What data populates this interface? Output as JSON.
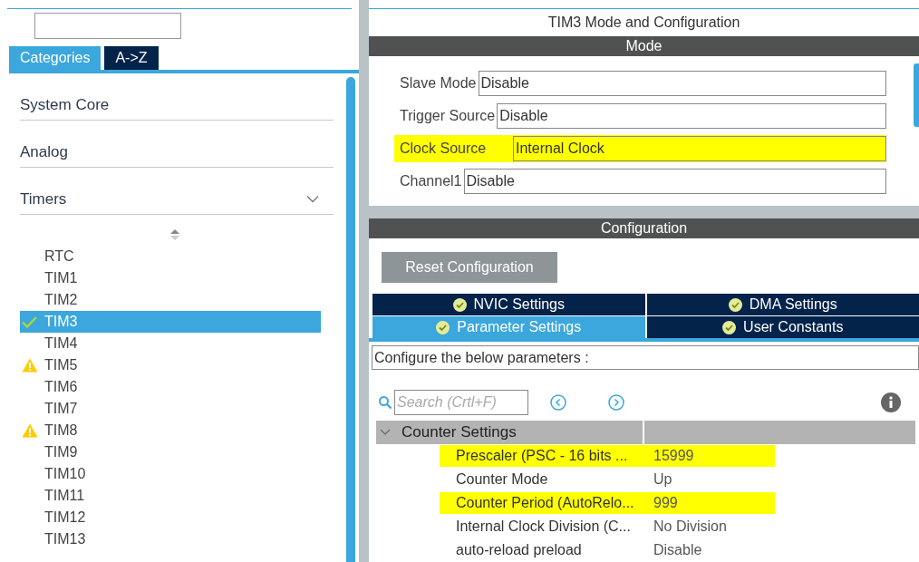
{
  "category_tabs": [
    {
      "label": "Categories",
      "selected": true
    },
    {
      "label": "A->Z",
      "selected": false
    }
  ],
  "categories": [
    {
      "label": "System Core"
    },
    {
      "label": "Analog"
    },
    {
      "label": "Timers",
      "expanded": true,
      "children": [
        {
          "label": "RTC",
          "selected": false,
          "configured": false,
          "warning": false
        },
        {
          "label": "TIM1",
          "selected": false,
          "configured": false,
          "warning": false
        },
        {
          "label": "TIM2",
          "selected": false,
          "configured": false,
          "warning": false
        },
        {
          "label": "TIM3",
          "selected": true,
          "configured": true,
          "warning": false
        },
        {
          "label": "TIM4",
          "selected": false,
          "configured": false,
          "warning": false
        },
        {
          "label": "TIM5",
          "selected": false,
          "configured": false,
          "warning": true
        },
        {
          "label": "TIM6",
          "selected": false,
          "configured": false,
          "warning": false
        },
        {
          "label": "TIM7",
          "selected": false,
          "configured": false,
          "warning": false
        },
        {
          "label": "TIM8",
          "selected": false,
          "configured": false,
          "warning": true
        },
        {
          "label": "TIM9",
          "selected": false,
          "configured": false,
          "warning": false
        },
        {
          "label": "TIM10",
          "selected": false,
          "configured": false,
          "warning": false
        },
        {
          "label": "TIM11",
          "selected": false,
          "configured": false,
          "warning": false
        },
        {
          "label": "TIM12",
          "selected": false,
          "configured": false,
          "warning": false
        },
        {
          "label": "TIM13",
          "selected": false,
          "configured": false,
          "warning": false
        }
      ]
    }
  ],
  "title": "TIM3 Mode and Configuration",
  "mode": {
    "header": "Mode",
    "fields": [
      {
        "label": "Slave Mode",
        "value": "Disable",
        "highlighted": false
      },
      {
        "label": "Trigger Source",
        "value": "Disable",
        "highlighted": false
      },
      {
        "label": "Clock Source",
        "value": "Internal Clock",
        "highlighted": true
      },
      {
        "label": "Channel1",
        "value": "Disable",
        "highlighted": false
      }
    ]
  },
  "configuration": {
    "header": "Configuration",
    "reset_button": "Reset Configuration",
    "tabs": [
      {
        "label": "NVIC Settings",
        "selected": false
      },
      {
        "label": "DMA Settings",
        "selected": false
      },
      {
        "label": "Parameter Settings",
        "selected": true
      },
      {
        "label": "User Constants",
        "selected": false
      }
    ],
    "description": "Configure the below parameters :",
    "search": {
      "placeholder": "Search (Crtl+F)"
    },
    "groups": [
      {
        "label": "Counter Settings",
        "expanded": true,
        "children": [
          {
            "name": "Prescaler (PSC - 16 bits ...",
            "value": "15999",
            "highlighted": true
          },
          {
            "name": "Counter Mode",
            "value": "Up",
            "highlighted": false
          },
          {
            "name": "Counter Period (AutoRelo...",
            "value": "999",
            "highlighted": true
          },
          {
            "name": "Internal Clock Division (C...",
            "value": "No Division",
            "highlighted": false
          },
          {
            "name": "auto-reload preload",
            "value": "Disable",
            "highlighted": false
          }
        ]
      }
    ]
  }
}
